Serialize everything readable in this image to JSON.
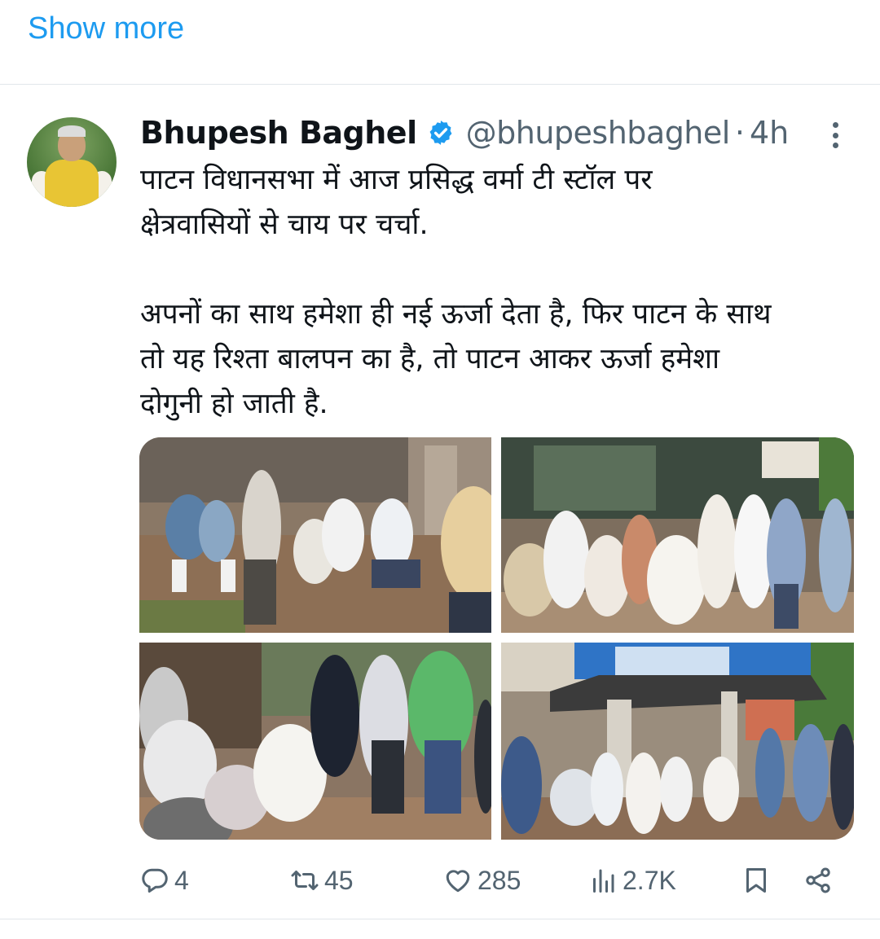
{
  "show_more": "Show more",
  "tweet": {
    "author_name": "Bhupesh Baghel",
    "handle": "@bhupeshbaghel",
    "separator": "·",
    "time": "4h",
    "text_lines": [
      "पाटन विधानसभा में आज प्रसिद्ध वर्मा टी स्टॉल पर",
      "क्षेत्रवासियों से चाय पर चर्चा.",
      "अपनों का साथ हमेशा ही नई ऊर्जा देता है, फिर पाटन के साथ",
      "तो यह रिश्ता बालपन का है, तो पाटन आकर ऊर्जा हमेशा",
      "दोगुनी हो जाती है."
    ],
    "stats": {
      "replies": "4",
      "reposts": "45",
      "likes": "285",
      "views": "2.7K"
    }
  },
  "colors": {
    "accent": "#1d9bf0",
    "muted_text": "#536471",
    "text": "#0f1419",
    "divider": "#e1e6ea"
  },
  "icons": {
    "verified": "verified-badge-icon",
    "more": "more-vertical-icon",
    "reply": "reply-icon",
    "repost": "repost-icon",
    "like": "heart-icon",
    "views": "views-icon",
    "bookmark": "bookmark-icon",
    "share": "share-icon"
  }
}
